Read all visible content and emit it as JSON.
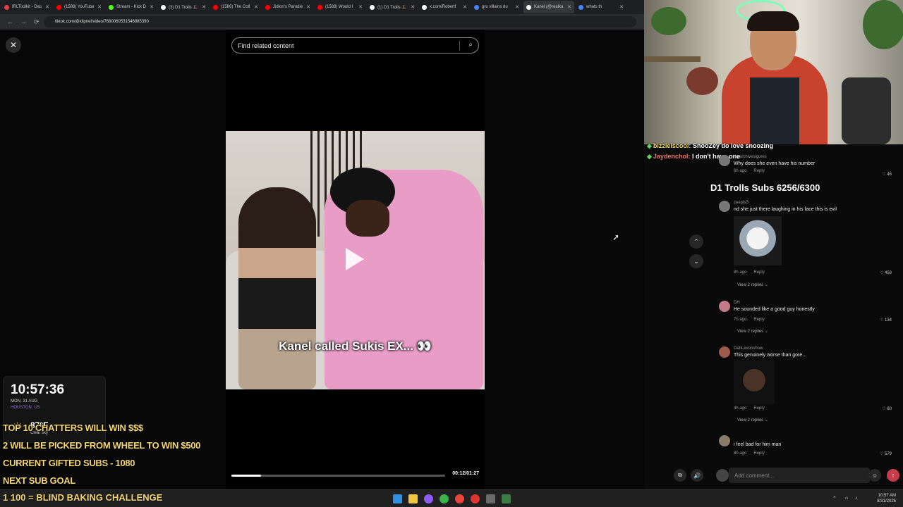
{
  "browser": {
    "tabs": [
      {
        "label": "IRLToolkit - Das",
        "color": "#e04040"
      },
      {
        "label": "(1586) YouTube",
        "color": "#ff0000"
      },
      {
        "label": "Stream - Kick D",
        "color": "#53fc18"
      },
      {
        "label": "(3) D1 Trolls 🎩",
        "color": "#ffffff"
      },
      {
        "label": "(1586) The Coll",
        "color": "#ff0000"
      },
      {
        "label": "Jidion's Parodie",
        "color": "#ff0000"
      },
      {
        "label": "(1588) Would I",
        "color": "#ff0000"
      },
      {
        "label": "(1) D1 Trolls 🎩",
        "color": "#ffffff"
      },
      {
        "label": "x.com/Robertf",
        "color": "#ffffff"
      },
      {
        "label": "gru villains du",
        "color": "#4285f4"
      },
      {
        "label": "Kanel (@realka",
        "color": "#ffffff"
      },
      {
        "label": "whats th",
        "color": "#4285f4"
      }
    ],
    "active_tab": 10,
    "url": "tiktok.com/@klipnel/video/7680060531546885390",
    "nav": {
      "back": "←",
      "forward": "→",
      "reload": "⟳"
    }
  },
  "tiktok": {
    "close": "✕",
    "search_placeholder": "Find related content",
    "caption": "Kanel called Sukis EX... 👀",
    "progress": 0.14,
    "time": "00:12/01:27"
  },
  "chat": [
    {
      "user": "bizzleIscool:",
      "msg": "SnooZey do love snoozing",
      "user_color": "#f3e06a"
    },
    {
      "user": "Jaydenchol:",
      "msg": "I don't have one",
      "user_color": "#f07a6f"
    }
  ],
  "subs_goal": "D1 Trolls Subs 6256/6300",
  "comments": [
    {
      "name": "myarchivesigures",
      "text": "Why does she even have his number",
      "age": "6h ago",
      "reply": "Reply",
      "likes": "46"
    },
    {
      "name": "zeepts3",
      "text": "nd she just there laughing in his face this is evil",
      "age": "8h ago",
      "reply": "Reply",
      "likes": "458",
      "view_replies": "View 2 replies ⌄"
    },
    {
      "name": "DH",
      "text": "He sounded like a good guy honestly",
      "age": "7h ago",
      "reply": "Reply",
      "likes": "134",
      "view_replies": "View 2 replies ⌄"
    },
    {
      "name": "DahLevonshow",
      "text": "This genuinely worse than gore...",
      "age": "4h ago",
      "reply": "Reply",
      "likes": "60",
      "view_replies": "View 2 replies ⌄"
    },
    {
      "name": "",
      "text": "i feel bad for him man",
      "age": "8h ago",
      "reply": "Reply",
      "likes": "579"
    }
  ],
  "comment_input": "Add comment...",
  "clock": {
    "time": "10:57:36",
    "date": "MON, 31 AUG",
    "location": "HOUSTON, US",
    "temp": "87°F",
    "condition": "Clear sky",
    "weather_icon": "☀"
  },
  "overlay_lines": [
    "TOP 10 CHATTERS WILL WIN $$$",
    "2 WILL BE PICKED FROM WHEEL TO WIN $500",
    "CURRENT GIFTED SUBS - 1080",
    "NEXT SUB GOAL"
  ],
  "ticker": "1 100 = BLIND BAKING CHALLENGE",
  "tray": {
    "time": "10:57 AM",
    "date": "8/31/2026"
  }
}
